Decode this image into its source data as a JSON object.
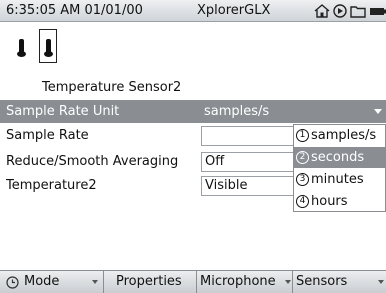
{
  "statusbar": {
    "time": "6:35:05 AM 01/01/00",
    "app_title": "XplorerGLX",
    "icons": [
      "home-icon",
      "play-icon",
      "folder-icon",
      "battery-icon"
    ]
  },
  "sensors": [
    {
      "icon": "thermometer-icon",
      "selected": false
    },
    {
      "icon": "thermometer-icon",
      "selected": true
    }
  ],
  "sensor_label": "Temperature Sensor2",
  "properties": [
    {
      "label": "Sample Rate Unit",
      "value": "samples/s",
      "selected": true
    },
    {
      "label": "Sample Rate",
      "value": "",
      "selected": false
    },
    {
      "label": "Reduce/Smooth Averaging",
      "value": "Off",
      "selected": false
    },
    {
      "label": "Temperature2",
      "value": "Visible",
      "selected": false
    }
  ],
  "dropdown": {
    "options": [
      {
        "num": "1",
        "label": "samples/s"
      },
      {
        "num": "2",
        "label": "seconds"
      },
      {
        "num": "3",
        "label": "minutes"
      },
      {
        "num": "4",
        "label": "hours"
      }
    ],
    "highlighted": "seconds"
  },
  "menubar": {
    "mode": "Mode",
    "properties": "Properties",
    "microphone": "Microphone",
    "sensors": "Sensors"
  },
  "colors": {
    "selection": "#8a8e93",
    "background": "#ffffff"
  }
}
